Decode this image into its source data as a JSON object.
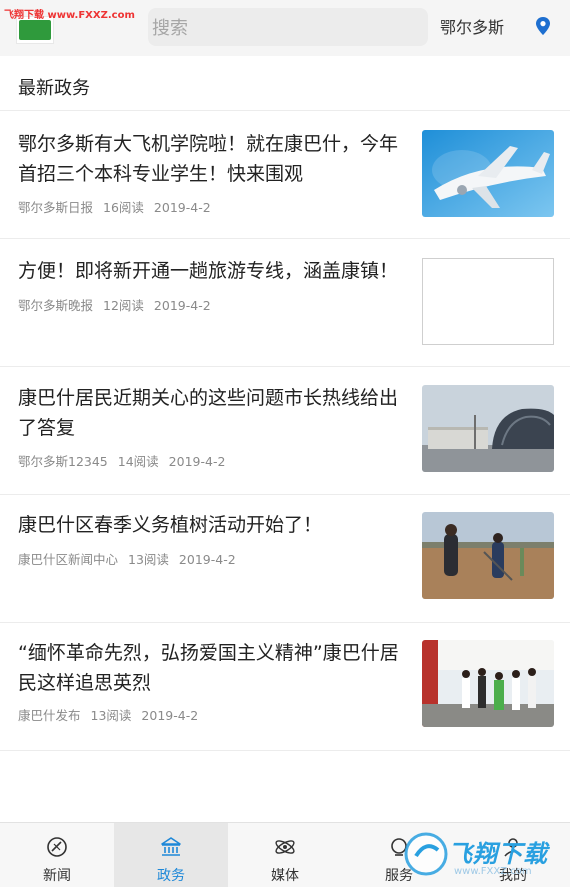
{
  "watermark": {
    "top_text": "飞翔下载 www.FXXZ.com",
    "bottom_text": "飞翔下载",
    "bottom_url": "www.FXXZ.com"
  },
  "header": {
    "search_placeholder": "搜索",
    "city": "鄂尔多斯"
  },
  "section": {
    "title": "最新政务"
  },
  "news": [
    {
      "title": "鄂尔多斯有大飞机学院啦！就在康巴什，今年首招三个本科专业学生！快来围观",
      "source": "鄂尔多斯日报",
      "reads": "16阅读",
      "date": "2019-4-2"
    },
    {
      "title": "方便！即将新开通一趟旅游专线，涵盖康镇！",
      "source": "鄂尔多斯晚报",
      "reads": "12阅读",
      "date": "2019-4-2"
    },
    {
      "title": "康巴什居民近期关心的这些问题市长热线给出了答复",
      "source": "鄂尔多斯12345",
      "reads": "14阅读",
      "date": "2019-4-2"
    },
    {
      "title": "康巴什区春季义务植树活动开始了！",
      "source": "康巴什区新闻中心",
      "reads": "13阅读",
      "date": "2019-4-2"
    },
    {
      "title": "“缅怀革命先烈，弘扬爱国主义精神”康巴什居民这样追思英烈",
      "source": "康巴什发布",
      "reads": "13阅读",
      "date": "2019-4-2"
    }
  ],
  "tabs": [
    {
      "label": "新闻",
      "icon": "news-icon"
    },
    {
      "label": "政务",
      "icon": "government-icon",
      "active": true
    },
    {
      "label": "媒体",
      "icon": "media-icon"
    },
    {
      "label": "服务",
      "icon": "service-icon"
    },
    {
      "label": "我的",
      "icon": "profile-icon"
    }
  ],
  "colors": {
    "accent": "#1e88d8",
    "logo_green": "#2f9a3c",
    "location_pin": "#1e6fd0"
  }
}
